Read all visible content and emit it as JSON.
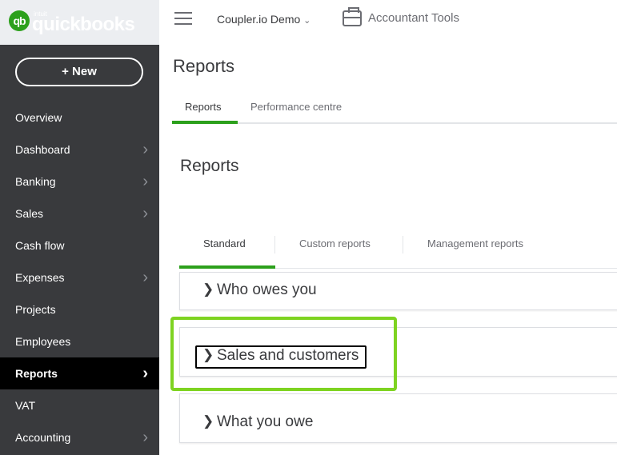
{
  "brand": {
    "intuit": "intuit",
    "name": "quickbooks",
    "mark": "qb"
  },
  "sidebar": {
    "new_label": "+  New",
    "items": [
      {
        "label": "Overview",
        "chevron": false
      },
      {
        "label": "Dashboard",
        "chevron": true
      },
      {
        "label": "Banking",
        "chevron": true
      },
      {
        "label": "Sales",
        "chevron": true
      },
      {
        "label": "Cash flow",
        "chevron": false
      },
      {
        "label": "Expenses",
        "chevron": true
      },
      {
        "label": "Projects",
        "chevron": false
      },
      {
        "label": "Employees",
        "chevron": false
      },
      {
        "label": "Reports",
        "chevron": true,
        "active": true
      },
      {
        "label": "VAT",
        "chevron": false
      },
      {
        "label": "Accounting",
        "chevron": true
      }
    ]
  },
  "topbar": {
    "company": "Coupler.io Demo",
    "accountant_tools": "Accountant Tools"
  },
  "page": {
    "title": "Reports",
    "tabs": [
      "Reports",
      "Performance centre"
    ],
    "active_tab": "Reports"
  },
  "reports": {
    "heading": "Reports",
    "tabs": [
      "Standard",
      "Custom reports",
      "Management reports"
    ],
    "active_tab": "Standard",
    "sections": [
      "Who owes you",
      "Sales and customers",
      "What you owe"
    ],
    "highlighted": "Sales and customers"
  },
  "colors": {
    "sidebar": "#393a3d",
    "accent": "#2ca01c",
    "highlight": "#7ed321"
  }
}
